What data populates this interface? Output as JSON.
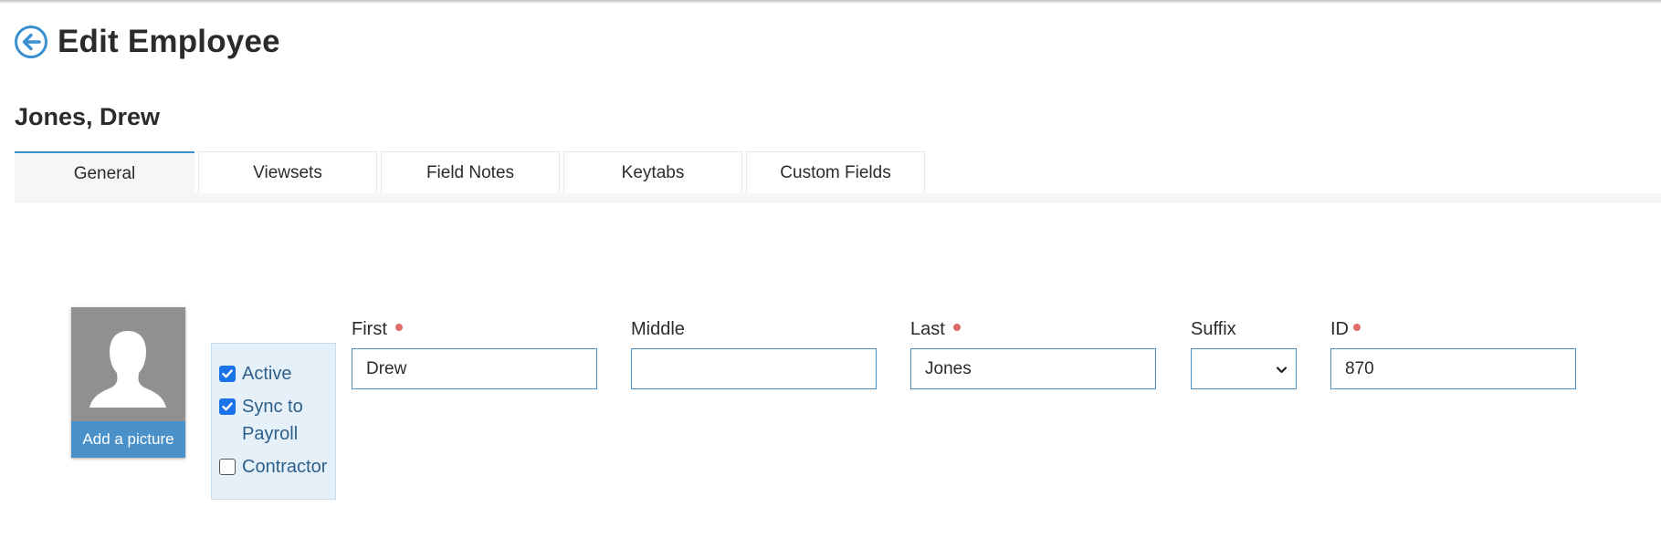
{
  "header": {
    "title": "Edit Employee",
    "back_icon": "arrow-left-circle-icon"
  },
  "employee": {
    "display_name": "Jones, Drew"
  },
  "tabs": [
    {
      "label": "General",
      "active": true
    },
    {
      "label": "Viewsets",
      "active": false
    },
    {
      "label": "Field Notes",
      "active": false
    },
    {
      "label": "Keytabs",
      "active": false
    },
    {
      "label": "Custom Fields",
      "active": false
    }
  ],
  "photo": {
    "placeholder_icon": "person-silhouette-icon",
    "add_label": "Add a picture"
  },
  "status": {
    "active": {
      "label": "Active",
      "checked": true
    },
    "sync_payroll": {
      "label": "Sync to Payroll",
      "checked": true
    },
    "contractor": {
      "label": "Contractor",
      "checked": false
    }
  },
  "fields": {
    "first": {
      "label": "First",
      "value": "Drew",
      "required": true
    },
    "middle": {
      "label": "Middle",
      "value": "",
      "required": false
    },
    "last": {
      "label": "Last",
      "value": "Jones",
      "required": true
    },
    "suffix": {
      "label": "Suffix",
      "value": "",
      "required": false
    },
    "id": {
      "label": "ID",
      "value": "870",
      "required": true
    }
  },
  "colors": {
    "accent": "#4a90c9",
    "required_dot": "#e06b6b",
    "checkbox_checked": "#1a73e8",
    "status_panel_bg": "#e6f0f8"
  }
}
